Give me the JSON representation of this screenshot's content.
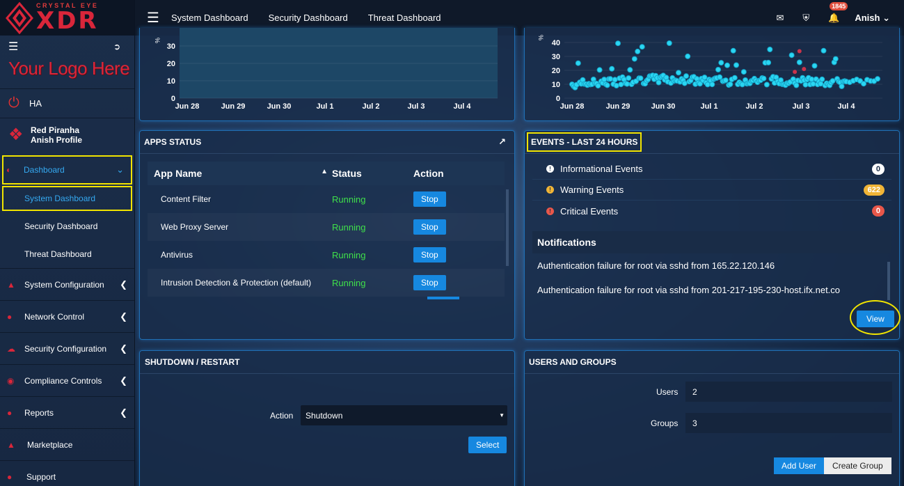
{
  "brand": {
    "small": "CRYSTAL EYE",
    "big": "XDR"
  },
  "sidebar": {
    "logo_text": "Your Logo Here",
    "ha_label": "HA",
    "profile": {
      "name": "Red Piranha",
      "sub": "Anish Profile"
    },
    "dashboard_label": "Dashboard",
    "sub_items": [
      "System Dashboard",
      "Security Dashboard",
      "Threat Dashboard"
    ],
    "items": [
      "System Configuration",
      "Network Control",
      "Security Configuration",
      "Compliance Controls",
      "Reports",
      "Marketplace",
      "Support"
    ]
  },
  "topbar": {
    "tabs": [
      "System Dashboard",
      "Security Dashboard",
      "Threat Dashboard"
    ],
    "notification_count": "1845",
    "user": "Anish"
  },
  "chart_left": {
    "y_ticks": [
      "30",
      "20",
      "10",
      "0"
    ],
    "x_ticks": [
      "Jun 28",
      "Jun 29",
      "Jun 30",
      "Jul 1",
      "Jul 2",
      "Jul 3",
      "Jul 4"
    ]
  },
  "chart_right": {
    "y_ticks": [
      "40",
      "30",
      "20",
      "10",
      "0"
    ],
    "x_ticks": [
      "Jun 28",
      "Jun 29",
      "Jun 30",
      "Jul 1",
      "Jul 2",
      "Jul 3",
      "Jul 4"
    ]
  },
  "chart_data": [
    {
      "type": "area",
      "x": [
        "Jun 28",
        "Jun 29",
        "Jun 30",
        "Jul 1",
        "Jul 2",
        "Jul 3",
        "Jul 4"
      ],
      "series": [
        {
          "values": [
            0,
            0,
            0,
            0,
            0,
            0,
            0
          ]
        }
      ],
      "ylim": [
        0,
        35
      ]
    },
    {
      "type": "scatter",
      "x": [
        "Jun 28",
        "Jun 29",
        "Jun 30",
        "Jul 1",
        "Jul 2",
        "Jul 3",
        "Jul 4"
      ],
      "series": [
        {
          "values": [
            10,
            12,
            14,
            12,
            13,
            12,
            11
          ]
        }
      ],
      "ylim": [
        0,
        45
      ]
    }
  ],
  "apps_status": {
    "title": "APPS STATUS",
    "headers": {
      "name": "App Name",
      "status": "Status",
      "action": "Action"
    },
    "rows": [
      {
        "name": "Content Filter",
        "status": "Running",
        "action": "Stop"
      },
      {
        "name": "Web Proxy Server",
        "status": "Running",
        "action": "Stop"
      },
      {
        "name": "Antivirus",
        "status": "Running",
        "action": "Stop"
      },
      {
        "name": "Intrusion Detection & Protection (default)",
        "status": "Running",
        "action": "Stop"
      }
    ]
  },
  "events": {
    "title": "EVENTS - LAST 24 HOURS",
    "rows": [
      {
        "label": "Informational Events",
        "count": "0",
        "color": "#ffffff",
        "badge_bg": "#ffffff",
        "badge_fg": "#1a2c46"
      },
      {
        "label": "Warning Events",
        "count": "622",
        "color": "#f0b436",
        "badge_bg": "#f0b436",
        "badge_fg": "#ffffff"
      },
      {
        "label": "Critical Events",
        "count": "0",
        "color": "#e8574a",
        "badge_bg": "#e8574a",
        "badge_fg": "#ffffff"
      }
    ],
    "notifications_title": "Notifications",
    "notifications": [
      "Authentication failure for root via sshd from 165.22.120.146",
      "Authentication failure for root via sshd from 201-217-195-230-host.ifx.net.co"
    ],
    "view_label": "View"
  },
  "shutdown": {
    "title": "SHUTDOWN / RESTART",
    "action_label": "Action",
    "action_value": "Shutdown",
    "select_label": "Select"
  },
  "users_groups": {
    "title": "USERS AND GROUPS",
    "users_label": "Users",
    "users_value": "2",
    "groups_label": "Groups",
    "groups_value": "3",
    "add_user_label": "Add User",
    "create_group_label": "Create Group"
  }
}
